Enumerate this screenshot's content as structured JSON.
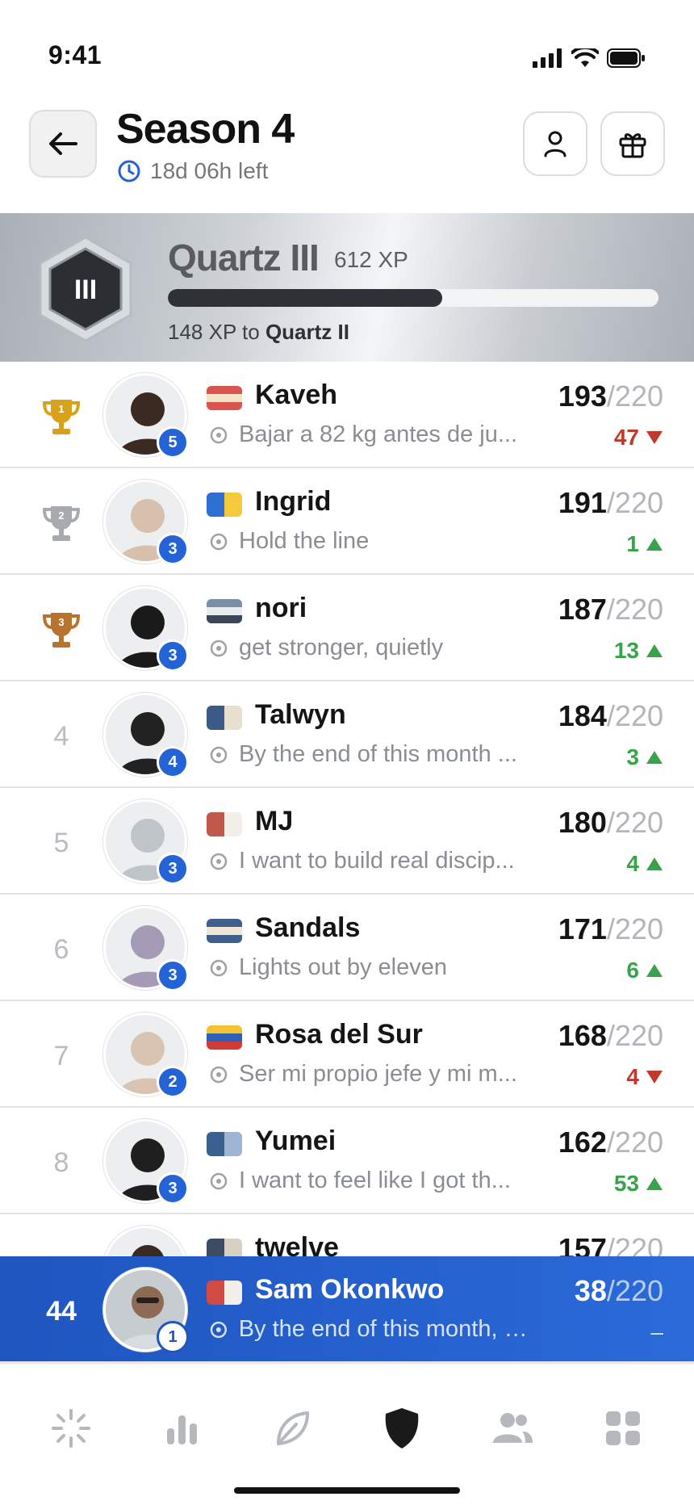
{
  "status": {
    "time": "9:41"
  },
  "header": {
    "title": "Season 4",
    "time_left": "18d 06h left"
  },
  "league": {
    "name": "Quartz III",
    "xp": "612 XP",
    "progress": 0.56,
    "progress_prefix": "148 XP to ",
    "next_league": "Quartz II",
    "badge_numeral": "III"
  },
  "players": [
    {
      "rank": "1",
      "name": "Kaveh",
      "goal": "Bajar a 82 kg antes de ju...",
      "score": "193",
      "max": "/220",
      "delta": "47",
      "dir": "down",
      "level": "5",
      "flag": [
        "#d9534f",
        "#f3e3c4",
        "#d9534f"
      ],
      "avatar": "#3b2a22"
    },
    {
      "rank": "2",
      "name": "Ingrid",
      "goal": "Hold the line",
      "score": "191",
      "max": "/220",
      "delta": "1",
      "dir": "up",
      "level": "3",
      "flag": [
        "#2f6fd1",
        "#f4c93b"
      ],
      "avatar": "#d7c1ae"
    },
    {
      "rank": "3",
      "name": "nori",
      "goal": "get stronger, quietly",
      "score": "187",
      "max": "/220",
      "delta": "13",
      "dir": "up",
      "level": "3",
      "flag": [
        "#7a8ea6",
        "#e8ecef",
        "#3b4656"
      ],
      "avatar": "#1a1a1a"
    },
    {
      "rank": "4",
      "name": "Talwyn",
      "goal": "By the end of this month ...",
      "score": "184",
      "max": "/220",
      "delta": "3",
      "dir": "up",
      "level": "4",
      "flag": [
        "#3c5a86",
        "#e9dfcf"
      ],
      "avatar": "#222222"
    },
    {
      "rank": "5",
      "name": "MJ",
      "goal": "I want to build real discip...",
      "score": "180",
      "max": "/220",
      "delta": "4",
      "dir": "up",
      "level": "3",
      "flag": [
        "#c0594a",
        "#f2efe8"
      ],
      "avatar": "#bfc4c8"
    },
    {
      "rank": "6",
      "name": "Sandals",
      "goal": "Lights out by eleven",
      "score": "171",
      "max": "/220",
      "delta": "6",
      "dir": "up",
      "level": "3",
      "flag": [
        "#3f5f8e",
        "#efe6d6",
        "#3f5f8e"
      ],
      "avatar": "#a69bb6"
    },
    {
      "rank": "7",
      "name": "Rosa del Sur",
      "goal": "Ser mi propio jefe y mi m...",
      "score": "168",
      "max": "/220",
      "delta": "4",
      "dir": "down",
      "level": "2",
      "flag": [
        "#f2c230",
        "#2c5fb8",
        "#cf3b36"
      ],
      "avatar": "#d9c4b3"
    },
    {
      "rank": "8",
      "name": "Yumei",
      "goal": "I want to feel like I got th...",
      "score": "162",
      "max": "/220",
      "delta": "53",
      "dir": "up",
      "level": "3",
      "flag": [
        "#3b5f8e",
        "#9db4d2"
      ],
      "avatar": "#1f1f1f"
    },
    {
      "rank": "",
      "name": "twelve",
      "goal": "",
      "score": "157",
      "max": "/220",
      "delta": "",
      "dir": "up",
      "level": "",
      "flag": [
        "#3b4c64",
        "#d8d0c2"
      ],
      "avatar": "#3a2a22"
    }
  ],
  "me": {
    "rank": "44",
    "name": "Sam Okonkwo",
    "goal": "By the end of this month, I ...",
    "score": "38",
    "max": "/220",
    "delta": "–",
    "level": "1",
    "flag": [
      "#d24b43",
      "#f3eeea"
    ]
  },
  "tabs": [
    {
      "name": "tab-today",
      "icon": "sparkle-icon"
    },
    {
      "name": "tab-stats",
      "icon": "bar-chart-icon"
    },
    {
      "name": "tab-journal",
      "icon": "leaf-icon"
    },
    {
      "name": "tab-league",
      "icon": "shield-icon",
      "active": true
    },
    {
      "name": "tab-friends",
      "icon": "people-icon"
    },
    {
      "name": "tab-more",
      "icon": "grid-icon"
    }
  ],
  "colors": {
    "accent": "#2463d6",
    "up": "#3aa24a",
    "down": "#c0392b",
    "gold": "#d7a21a",
    "silver": "#a7abb0",
    "bronze": "#b8732e"
  }
}
